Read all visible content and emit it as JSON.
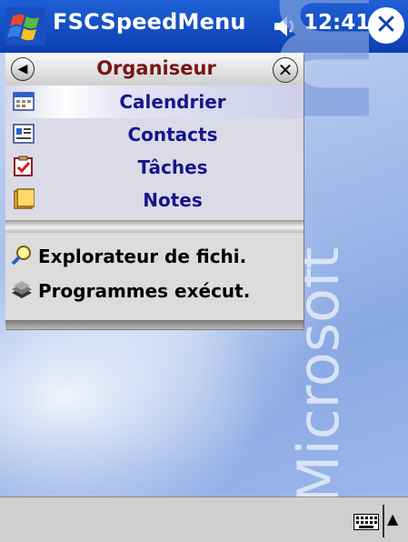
{
  "title_bar": {
    "app_title": "FSCSpeedMenu",
    "time": "12:41",
    "close_glyph": "✕",
    "start_icon": "windows-flag-icon",
    "volume_icon": "speaker-icon"
  },
  "wallpaper": {
    "watermark_big": "mobile",
    "watermark_small": "Microsoft"
  },
  "menu": {
    "back_glyph": "◀",
    "title": "Organiseur",
    "close_glyph": "✕",
    "items": [
      {
        "label": "Calendrier",
        "icon": "calendar-icon"
      },
      {
        "label": "Contacts",
        "icon": "contacts-icon"
      },
      {
        "label": "Tâches",
        "icon": "tasks-icon"
      },
      {
        "label": "Notes",
        "icon": "notes-icon"
      }
    ],
    "commands": [
      {
        "label": "Explorateur de fichi.",
        "icon": "file-explorer-icon"
      },
      {
        "label": "Programmes exécut.",
        "icon": "running-programs-icon"
      }
    ]
  },
  "bottom_bar": {
    "keyboard_icon": "keyboard-icon",
    "sip_arrow": "▲"
  },
  "colors": {
    "title_bar": "#0b3fb1",
    "menu_title": "#7a1515",
    "item_text": "#16168b"
  }
}
